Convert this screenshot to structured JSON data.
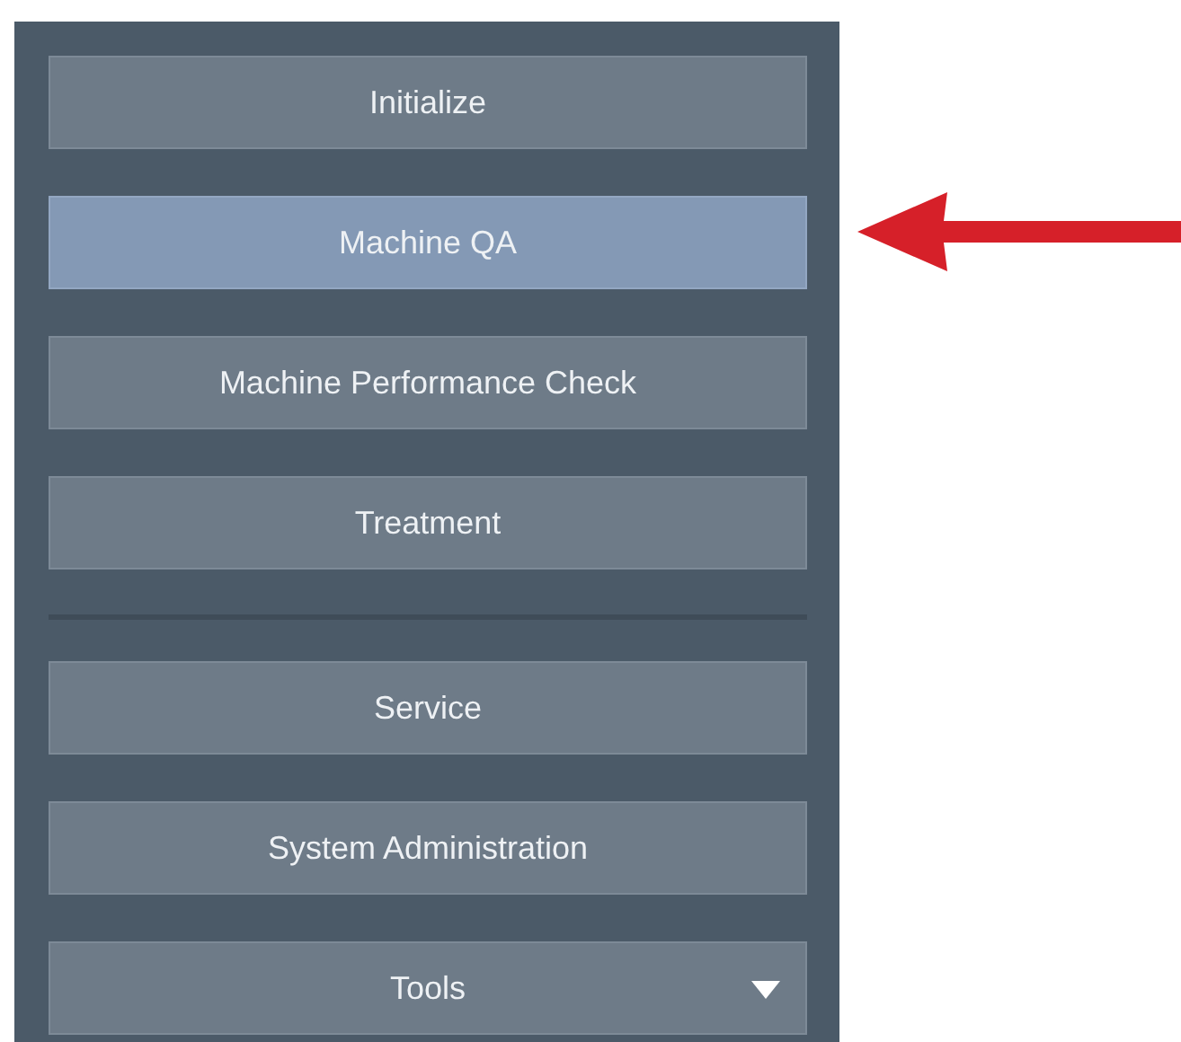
{
  "menu": {
    "groups": [
      {
        "items": [
          {
            "label": "Initialize",
            "selected": false,
            "dropdown": false
          },
          {
            "label": "Machine QA",
            "selected": true,
            "dropdown": false
          },
          {
            "label": "Machine Performance Check",
            "selected": false,
            "dropdown": false
          },
          {
            "label": "Treatment",
            "selected": false,
            "dropdown": false
          }
        ]
      },
      {
        "items": [
          {
            "label": "Service",
            "selected": false,
            "dropdown": false
          },
          {
            "label": "System Administration",
            "selected": false,
            "dropdown": false
          },
          {
            "label": "Tools",
            "selected": false,
            "dropdown": true
          }
        ]
      }
    ]
  }
}
